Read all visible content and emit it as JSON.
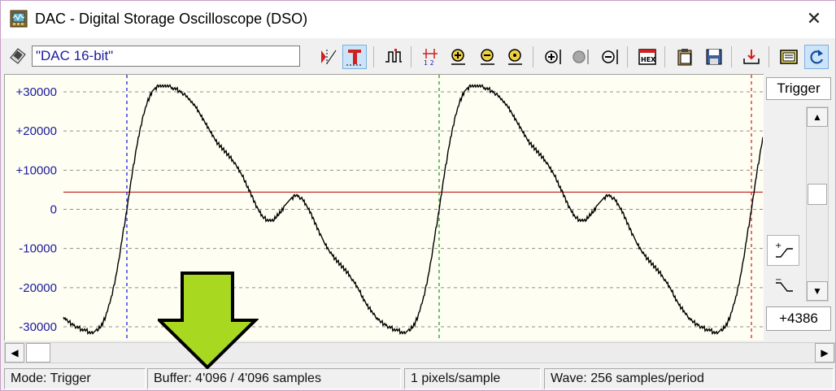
{
  "window": {
    "title": "DAC - Digital Storage Oscilloscope (DSO)",
    "close_glyph": "✕",
    "icon": "oscilloscope-app-icon"
  },
  "toolbar": {
    "source_value": "\"DAC 16-bit\"",
    "buttons": [
      {
        "name": "trigger-edge-button",
        "icon": "trigger-marker-icon",
        "active": false
      },
      {
        "name": "trigger-mode-button",
        "icon": "trigger-t-icon",
        "active": true
      },
      {
        "name": "signal-generator-button",
        "icon": "square-wave-icon",
        "active": false
      },
      {
        "name": "cursor-button",
        "icon": "cursors-icon",
        "active": false
      },
      {
        "name": "zoom-in-button",
        "icon": "zoom-in-icon",
        "active": false
      },
      {
        "name": "zoom-out-button",
        "icon": "zoom-out-icon",
        "active": false
      },
      {
        "name": "zoom-reset-button",
        "icon": "zoom-reset-icon",
        "active": false
      },
      {
        "name": "v-zoom-in-button",
        "icon": "v-zoom-in-icon",
        "active": false
      },
      {
        "name": "v-zoom-fit-button",
        "icon": "v-zoom-fit-icon",
        "active": false
      },
      {
        "name": "v-zoom-out-button",
        "icon": "v-zoom-out-icon",
        "active": false
      },
      {
        "name": "hex-display-button",
        "icon": "hex-icon",
        "active": false
      },
      {
        "name": "copy-button",
        "icon": "clipboard-icon",
        "active": false
      },
      {
        "name": "save-button",
        "icon": "floppy-disk-icon",
        "active": false
      },
      {
        "name": "export-button",
        "icon": "download-icon",
        "active": false
      },
      {
        "name": "display-button",
        "icon": "display-icon",
        "active": false
      },
      {
        "name": "refresh-button",
        "icon": "refresh-icon",
        "active": true
      }
    ]
  },
  "plot": {
    "y_ticks": [
      "+30000",
      "+20000",
      "+10000",
      "0",
      "-10000",
      "-20000",
      "-30000"
    ],
    "trigger_level": 4386,
    "colors": {
      "background": "#fefef2",
      "grid": "#909090",
      "waveform": "#000000",
      "trigger_level": "#c03030",
      "cursor_a": "#2020e0",
      "cursor_b": "#20a020",
      "cursor_c": "#e02020",
      "tick_label": "#1a1aa0"
    }
  },
  "side": {
    "trigger_label": "Trigger",
    "trigger_value": "+4386",
    "rising_edge_active": true
  },
  "status": {
    "mode": "Mode: Trigger",
    "buffer": "Buffer:  4'096 / 4'096 samples",
    "zoom": "1 pixels/sample",
    "wave": "Wave: 256 samples/period"
  },
  "annotation": {
    "arrow_color": "#a8d820"
  }
}
